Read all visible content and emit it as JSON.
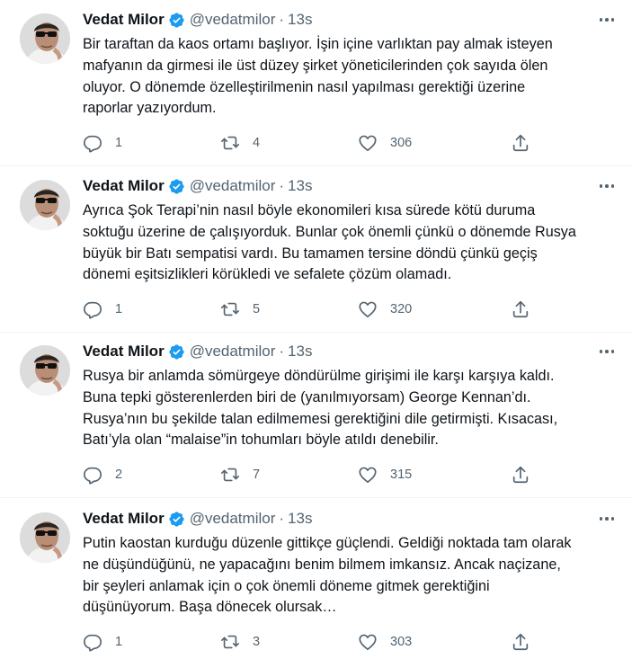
{
  "tweets": [
    {
      "name": "Vedat Milor",
      "handle": "@vedatmilor",
      "separator": "·",
      "time": "13s",
      "lines": [
        "Bir taraftan da kaos ortamı başlıyor. İşin içine varlıktan pay almak isteyen",
        "mafyanın da girmesi ile üst düzey şirket yöneticilerinden çok sayıda ölen",
        "oluyor. O dönemde özelleştirilmenin nasıl yapılması gerektiği üzerine",
        "raporlar yazıyordum."
      ],
      "replies": "1",
      "retweets": "4",
      "likes": "306"
    },
    {
      "name": "Vedat Milor",
      "handle": "@vedatmilor",
      "separator": "·",
      "time": "13s",
      "lines": [
        "Ayrıca Şok Terapi’nin nasıl böyle ekonomileri kısa sürede kötü duruma",
        "soktuğu üzerine de çalışıyorduk. Bunlar çok önemli çünkü o dönemde Rusya",
        "büyük bir Batı sempatisi vardı. Bu tamamen tersine döndü çünkü geçiş",
        "dönemi eşitsizlikleri körükledi ve sefalete çözüm olamadı."
      ],
      "replies": "1",
      "retweets": "5",
      "likes": "320"
    },
    {
      "name": "Vedat Milor",
      "handle": "@vedatmilor",
      "separator": "·",
      "time": "13s",
      "lines": [
        "Rusya bir anlamda sömürgeye döndürülme girişimi ile karşı karşıya kaldı.",
        "Buna tepki gösterenlerden biri de (yanılmıyorsam) George Kennan’dı.",
        "Rusya’nın bu şekilde talan edilmemesi gerektiğini dile getirmişti. Kısacası,",
        "Batı’yla olan “malaise”in tohumları böyle atıldı denebilir."
      ],
      "replies": "2",
      "retweets": "7",
      "likes": "315"
    },
    {
      "name": "Vedat Milor",
      "handle": "@vedatmilor",
      "separator": "·",
      "time": "13s",
      "lines": [
        "Putin kaostan kurduğu düzenle gittikçe güçlendi. Geldiği noktada tam olarak",
        "ne düşündüğünü, ne yapacağını benim bilmem imkansız. Ancak naçizane,",
        "bir şeyleri anlamak için o çok önemli döneme gitmek gerektiğini",
        "düşünüyorum. Başa dönecek olursak…"
      ],
      "replies": "1",
      "retweets": "3",
      "likes": "303"
    }
  ],
  "icons": {
    "verified": "verified-badge-icon",
    "more": "more-options-icon",
    "reply": "reply-icon",
    "retweet": "retweet-icon",
    "like": "heart-icon",
    "share": "share-icon"
  },
  "colors": {
    "verified_blue": "#1d9bf0",
    "secondary_text": "#536471",
    "primary_text": "#0f1419"
  }
}
